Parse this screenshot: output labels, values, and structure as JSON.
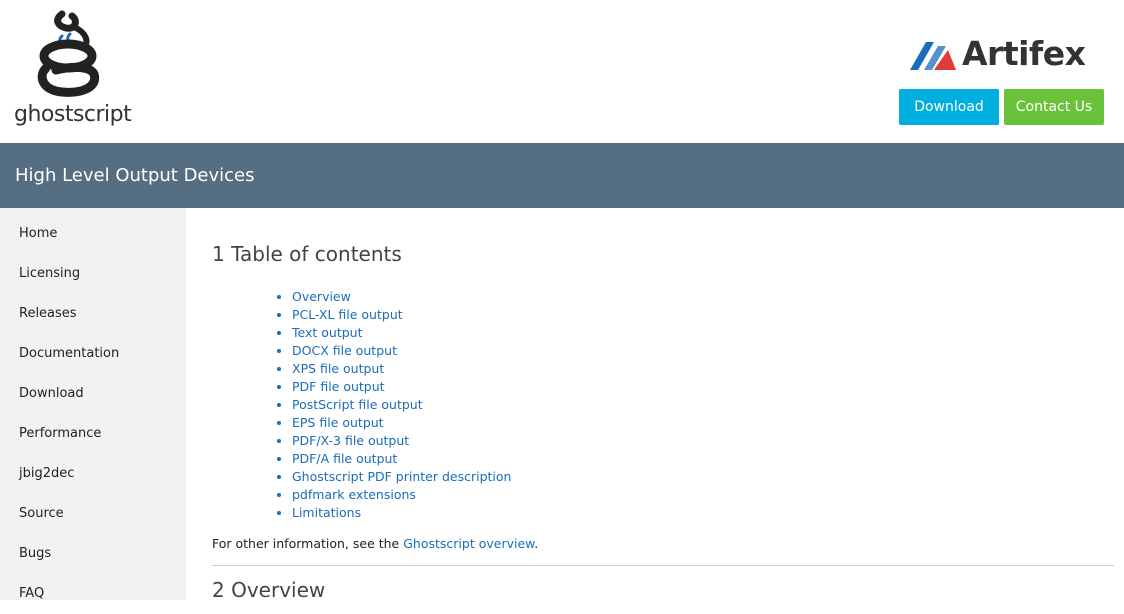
{
  "header": {
    "ghostscript_word": "ghostscript",
    "artifex_word": "Artifex",
    "download_label": "Download",
    "contact_label": "Contact Us"
  },
  "title_bar": {
    "title": "High Level Output Devices"
  },
  "sidebar": {
    "items": [
      {
        "label": "Home"
      },
      {
        "label": "Licensing"
      },
      {
        "label": "Releases"
      },
      {
        "label": "Documentation"
      },
      {
        "label": "Download"
      },
      {
        "label": "Performance"
      },
      {
        "label": "jbig2dec"
      },
      {
        "label": "Source"
      },
      {
        "label": "Bugs"
      },
      {
        "label": "FAQ"
      }
    ]
  },
  "content": {
    "toc_heading": "1 Table of contents",
    "toc_items": [
      {
        "label": "Overview"
      },
      {
        "label": "PCL-XL file output"
      },
      {
        "label": "Text output"
      },
      {
        "label": "DOCX file output"
      },
      {
        "label": "XPS file output"
      },
      {
        "label": "PDF file output"
      },
      {
        "label": "PostScript file output"
      },
      {
        "label": "EPS file output"
      },
      {
        "label": "PDF/X-3 file output"
      },
      {
        "label": "PDF/A file output"
      },
      {
        "label": "Ghostscript PDF printer description"
      },
      {
        "label": "pdfmark extensions"
      },
      {
        "label": "Limitations"
      }
    ],
    "info_prefix": "For other information, see the ",
    "info_link": "Ghostscript overview",
    "info_suffix": ".",
    "next_heading": "2 Overview"
  },
  "colors": {
    "title_bar": "#566e82",
    "download_button": "#00aee0",
    "contact_button": "#6ac23a",
    "link": "#1a6db8",
    "sidebar_bg": "#f2f2f2"
  },
  "icons": {
    "ghostscript_logo": "ghostscript-logo-icon",
    "artifex_logo": "artifex-logo-icon"
  }
}
